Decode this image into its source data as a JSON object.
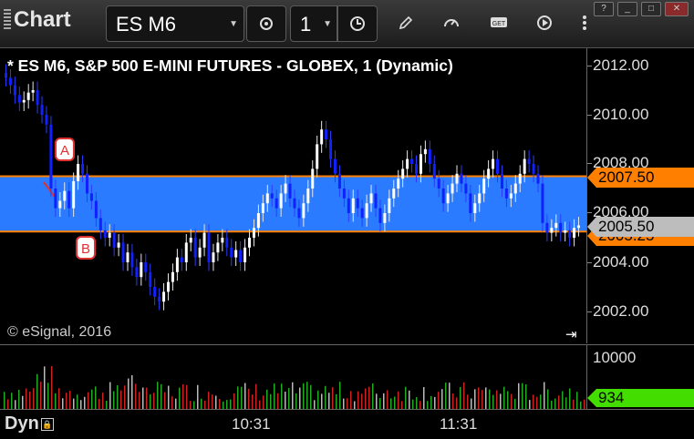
{
  "app": {
    "title": "Chart"
  },
  "toolbar": {
    "symbol": "ES M6",
    "interval": "1"
  },
  "chart": {
    "title": "* ES M6, S&P 500 E-MINI FUTURES - GLOBEX, 1 (Dynamic)",
    "copyright": "© eSignal, 2016",
    "price_labels": [
      "2012.00",
      "2010.00",
      "2008.00",
      "2006.00",
      "2004.00",
      "2002.00"
    ],
    "tags": {
      "upper": "2007.50",
      "lower": "2005.25",
      "last": "2005.50"
    },
    "markers": {
      "a": "A",
      "b": "B"
    },
    "band_color": "#2a7bff",
    "band_edge_color": "#ff7f00"
  },
  "volume": {
    "label": "10000",
    "last": "934"
  },
  "time_axis": {
    "mode": "Dyn",
    "ticks": [
      "10:31",
      "11:31"
    ]
  },
  "chart_data": {
    "type": "candlestick",
    "title": "* ES M6, S&P 500 E-MINI FUTURES - GLOBEX, 1 (Dynamic)",
    "ylim": [
      2001.5,
      2013.0
    ],
    "y_ticks": [
      2012,
      2010,
      2008,
      2006,
      2004,
      2002
    ],
    "band": [
      2005.25,
      2007.5
    ],
    "close": [
      2011.5,
      2011.2,
      2010.8,
      2010.5,
      2010.6,
      2010.9,
      2011.0,
      2010.4,
      2010.0,
      2009.6,
      2007.0,
      2006.2,
      2006.5,
      2006.9,
      2006.2,
      2007.3,
      2008.0,
      2007.6,
      2006.8,
      2006.5,
      2005.8,
      2005.3,
      2005.0,
      2005.2,
      2004.6,
      2004.8,
      2004.0,
      2004.4,
      2003.8,
      2003.4,
      2004.0,
      2003.6,
      2003.0,
      2002.6,
      2002.4,
      2002.8,
      2003.2,
      2003.6,
      2004.2,
      2004.0,
      2004.8,
      2005.0,
      2004.2,
      2004.6,
      2005.2,
      2004.0,
      2004.4,
      2004.8,
      2005.0,
      2004.6,
      2004.2,
      2004.5,
      2004.0,
      2004.6,
      2005.0,
      2005.4,
      2006.0,
      2006.4,
      2006.8,
      2006.6,
      2006.2,
      2006.8,
      2007.2,
      2006.6,
      2006.2,
      2005.8,
      2006.4,
      2007.0,
      2007.8,
      2008.8,
      2009.4,
      2009.0,
      2008.2,
      2007.6,
      2007.0,
      2006.6,
      2006.0,
      2006.6,
      2006.2,
      2005.8,
      2006.4,
      2006.8,
      2006.2,
      2005.6,
      2006.0,
      2006.6,
      2007.0,
      2007.4,
      2007.8,
      2008.2,
      2008.0,
      2007.6,
      2008.4,
      2008.6,
      2008.0,
      2007.4,
      2007.0,
      2006.4,
      2006.8,
      2007.2,
      2007.6,
      2007.2,
      2006.8,
      2006.0,
      2006.4,
      2006.8,
      2007.4,
      2007.8,
      2008.2,
      2007.6,
      2007.0,
      2006.6,
      2006.8,
      2007.2,
      2007.6,
      2008.2,
      2008.0,
      2007.6,
      2007.2,
      2005.6,
      2005.2,
      2005.4,
      2005.6,
      2005.2,
      2005.3,
      2005.0,
      2005.4,
      2005.5
    ],
    "volume_label": "10000",
    "volume_last": 934,
    "x_ticks": [
      "10:31",
      "11:31"
    ]
  }
}
